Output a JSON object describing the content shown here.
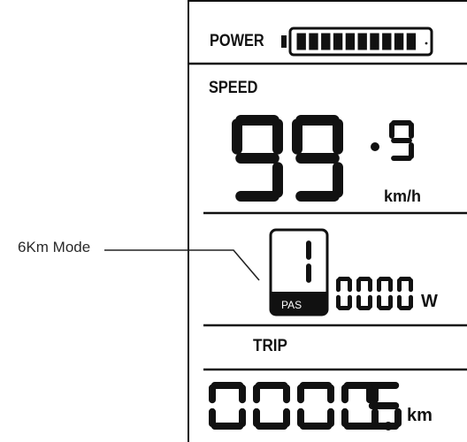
{
  "callout": {
    "label": "6Km Mode"
  },
  "power_row": {
    "label": "POWER",
    "battery_level": 1.0,
    "battery_bars": 10
  },
  "speed_row": {
    "label": "SPEED",
    "digits": "99",
    "decimal": "9",
    "unit": "km/h"
  },
  "assist_row": {
    "pas_level": "1",
    "pas_label": "PAS",
    "power_digits": "0000",
    "power_unit": "W"
  },
  "trip_row": {
    "label": "TRIP",
    "digits": "0000",
    "decimal": "5",
    "unit": "km"
  },
  "colors": {
    "segment": "#111111",
    "background": "#ffffff",
    "callout_text": "#2a2a2a"
  },
  "icons": {
    "battery": "battery-icon"
  }
}
